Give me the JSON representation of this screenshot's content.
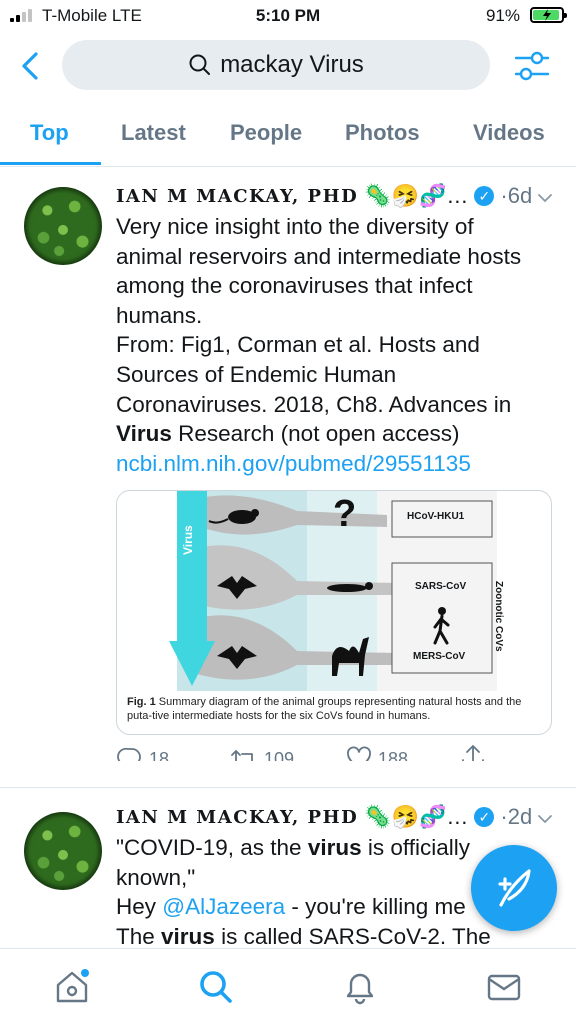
{
  "status_bar": {
    "carrier": "T-Mobile  LTE",
    "time": "5:10 PM",
    "battery": "91%"
  },
  "search": {
    "query": "mackay Virus"
  },
  "tabs": [
    {
      "label": "Top",
      "active": true
    },
    {
      "label": "Latest",
      "active": false
    },
    {
      "label": "People",
      "active": false
    },
    {
      "label": "Photos",
      "active": false
    },
    {
      "label": "Videos",
      "active": false
    }
  ],
  "tweets": [
    {
      "author": "IAN M MACKAY, PHD",
      "emojis": "🦠🤧🧬…",
      "time": "·6d",
      "lines": [
        "Very nice insight into the diversity of",
        "animal reservoirs and intermediate hosts",
        "among the coronaviruses that infect",
        "humans.",
        "From: Fig1, Corman et al. Hosts and",
        "Sources of Endemic Human",
        "Coronaviruses. 2018, Ch8. Advances in"
      ],
      "line8_bold": "Virus",
      "line8_rest": " Research (not open access)",
      "link": "ncbi.nlm.nih.gov/pubmed/29551135",
      "media": {
        "label_virus": "Virus",
        "question": "?",
        "box1": "HCoV-HKU1",
        "box2": "SARS-CoV",
        "box3": "MERS-CoV",
        "side_label": "Zoonotic CoVs",
        "caption_bold": "Fig. 1",
        "caption_text": "  Summary diagram of the animal groups representing natural hosts and the puta-tive intermediate hosts for the six CoVs found in humans."
      },
      "replies": "18",
      "retweets": "109",
      "likes": "188"
    },
    {
      "author": "IAN M MACKAY, PHD",
      "emojis": "🦠🤧🧬…",
      "time": "·2d",
      "line1_a": "\"COVID-19, as the ",
      "line1_bold": "virus",
      "line1_b": " is officially",
      "line2": "known,\"",
      "line3_a": "Hey ",
      "line3_mention": "@AlJazeera",
      "line3_b": " - you're killing me",
      "line4_a": "The ",
      "line4_bold": "virus",
      "line4_b": " is called SARS-CoV-2. The"
    }
  ],
  "colors": {
    "accent": "#1da1f2",
    "secondary_text": "#657786",
    "divider": "#e1e8ed"
  }
}
